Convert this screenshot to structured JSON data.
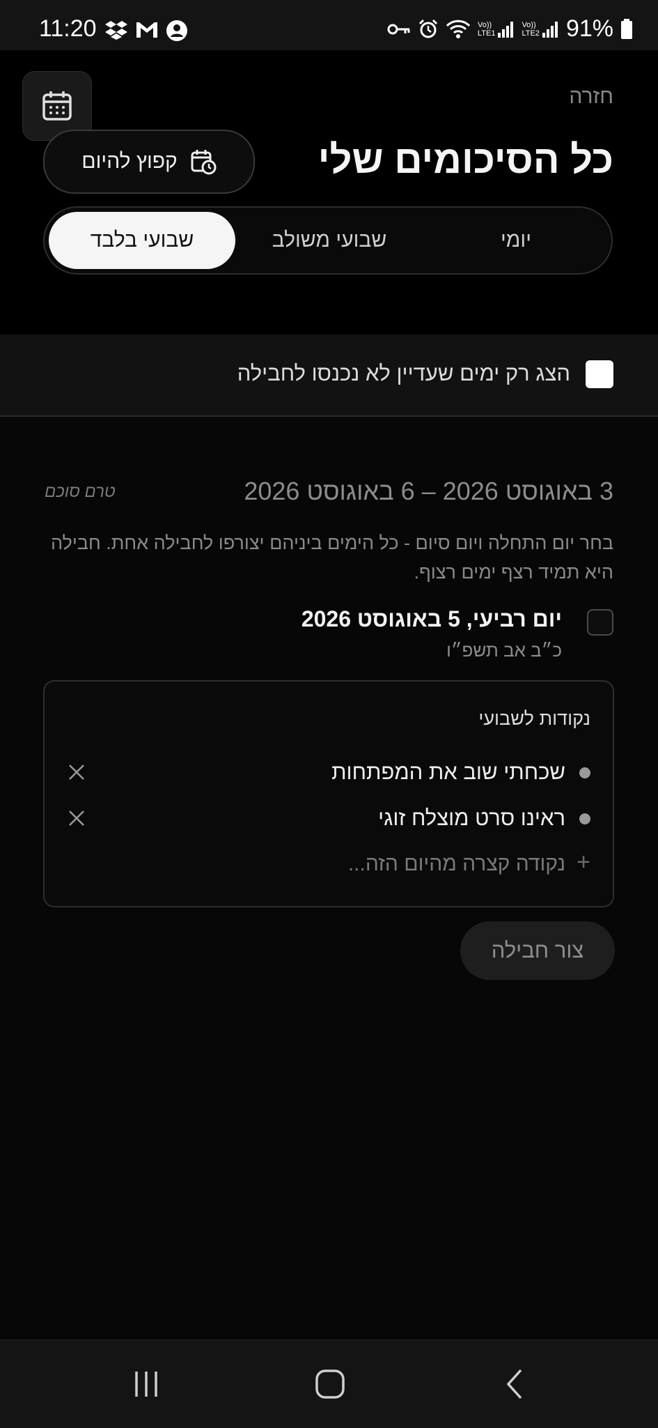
{
  "status_bar": {
    "time": "11:20",
    "battery_percent": "91%",
    "left_icons": [
      "dropbox-icon",
      "gmail-icon",
      "account-icon"
    ],
    "right_icons": [
      "vpn-key-icon",
      "alarm-icon",
      "wifi-icon",
      "signal-sim1-icon",
      "signal-sim2-icon",
      "battery-icon"
    ],
    "sim1_label": "LTE1",
    "sim2_label": "LTE2",
    "volte_label": "Vo))"
  },
  "header": {
    "back_label": "חזרה",
    "title": "כל הסיכומים שלי",
    "jump_today_label": "קפוץ להיום"
  },
  "tabs": {
    "daily": "יומי",
    "combined": "שבועי משולב",
    "weekly_only": "שבועי בלבד",
    "selected": "weekly_only"
  },
  "filter": {
    "label": "הצג רק ימים שעדיין לא נכנסו לחבילה",
    "checked": false
  },
  "range": {
    "title": "3 באוגוסט 2026 – 6 באוגוסט 2026",
    "status": "טרם סוכם",
    "instructions": "בחר יום התחלה ויום סיום - כל הימים ביניהם יצורפו לחבילה אחת. חבילה היא תמיד רצף ימים רצוף."
  },
  "day": {
    "title": "יום רביעי, 5 באוגוסט 2026",
    "hebrew_date": "כ״ב אב תשפ״ו",
    "checked": false
  },
  "weekly_points": {
    "heading": "נקודות לשבועי",
    "items": [
      "שכחתי שוב את המפתחות",
      "ראינו סרט מוצלח זוגי"
    ],
    "add_placeholder": "נקודה קצרה מהיום הזה..."
  },
  "actions": {
    "create_bundle_label": "צור חבילה"
  },
  "colors": {
    "background": "#070707",
    "surface": "#121212",
    "accent_selected": "#f5f5f5",
    "muted_text": "#8a8a8a"
  }
}
